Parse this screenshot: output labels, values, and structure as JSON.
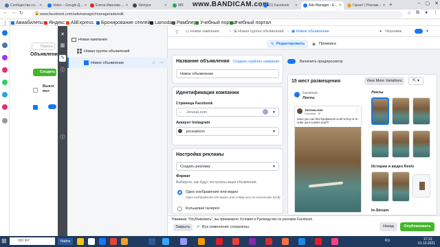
{
  "browser": {
    "tabs": [
      {
        "label": "Сообщества со...",
        "color": "#4a76a8"
      },
      {
        "label": "Video – Google Д...",
        "color": "#1a73e8"
      },
      {
        "label": "Елена Иванова ...",
        "color": "#e0262c"
      },
      {
        "label": "Teletype",
        "color": "#444444"
      },
      {
        "label": "MR",
        "color": "#2aa84a"
      },
      {
        "label": "(1) Facebook",
        "color": "#1877f2"
      },
      {
        "label": "Ads Manager - Е...",
        "color": "#1877f2"
      },
      {
        "label": "Гарант | Реклам...",
        "color": "#f0a030"
      }
    ],
    "watermark": "www.BANDICAM.com",
    "url": "www.facebook.com/adsmanager/manage/ads/edit",
    "bookmarks": [
      "Авиабилеты",
      "Яндекс",
      "AliExpress",
      "Бронирование отелей",
      "Lamoda",
      "Рамблер",
      "Учебный портал",
      "Учебный портал"
    ]
  },
  "background_table": {
    "title": "Объявления",
    "search_placeholder": "Поиск и",
    "create_label": "Создать",
    "column_header": "Выкл/\nвкл"
  },
  "tree": {
    "items": [
      {
        "label": "Новая кампания",
        "icon": "folder-icon"
      },
      {
        "label": "Новая группа объявлений",
        "icon": "grid-icon"
      },
      {
        "label": "Новое объявление",
        "icon": "ad-icon",
        "warning": "⚠"
      }
    ]
  },
  "crumbs": [
    "Новая кампания",
    "Новая группа объявлений",
    "Новое объявление"
  ],
  "draft": "Черновик",
  "tabs": {
    "edit": "Редактировать",
    "review": "Проверка"
  },
  "ad_name": {
    "heading": "Название объявления",
    "template_link": "Создать шаблон названия",
    "value": "Новое объявление"
  },
  "identity": {
    "heading": "Идентификация компании",
    "page_label": "Страница Facebook",
    "page_value": "JerusaLoom",
    "ig_label": "Аккаунт Instagram",
    "ig_value": "jerusaloom"
  },
  "setup": {
    "heading": "Настройка рекламы",
    "select_value": "Создать рекламу",
    "format_heading": "Формат",
    "format_hint": "Выберите, как будут построены ваши объявления.",
    "option1": "Одно изображение или видео",
    "option1_hint": "Одно изображение или видео или слайд-шоу из нескольких изображений",
    "option2": "Кольцевая галерея"
  },
  "preview": {
    "toggle_label": "Включить предпросмотр",
    "placements": "15 мест размещения",
    "more_variations": "View More Variations",
    "source": "Facebook",
    "feed_label": "Ленты",
    "post_name": "JerusaLoom",
    "post_meta": "Реклама · ⊕",
    "post_text": "Have you can find handwoven scarf to buy or to order your custom scarf?",
    "right_feeds": "Ленты",
    "right_stories": "Истории и видео Reels",
    "right_instream": "In-Stream"
  },
  "footer": {
    "notice": "Нажимая \"Опубликовать\", вы принимаете Условия и Руководство по рекламе Facebook.",
    "close": "Закрыть",
    "saved": "Все изменения сохранены",
    "back": "Назад",
    "publish": "Опубликовать"
  },
  "taskbar": {
    "search_placeholder": "360 ФР",
    "web_label": "Найти",
    "lang": "RU",
    "time": "17:13",
    "date": "01.10.2021"
  }
}
